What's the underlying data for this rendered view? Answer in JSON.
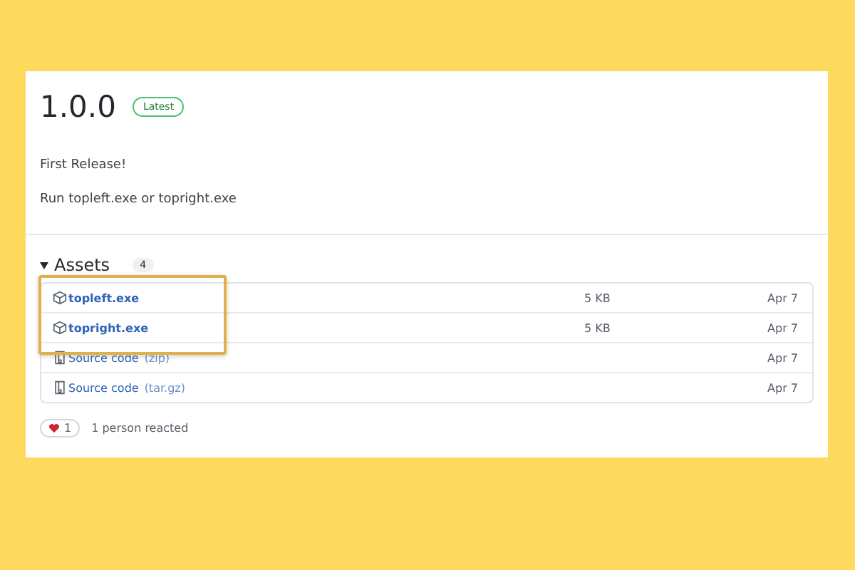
{
  "release": {
    "version": "1.0.0",
    "badge": "Latest",
    "notes": [
      "First Release!",
      "Run topleft.exe or topright.exe"
    ]
  },
  "assets": {
    "title": "Assets",
    "count": "4",
    "expanded": true,
    "items": [
      {
        "kind": "package",
        "name": "topleft.exe",
        "size": "5 KB",
        "date": "Apr 7",
        "highlighted": true
      },
      {
        "kind": "package",
        "name": "topright.exe",
        "size": "5 KB",
        "date": "Apr 7",
        "highlighted": true
      },
      {
        "kind": "source",
        "name": "Source code",
        "suffix": "(zip)",
        "date": "Apr 7",
        "highlighted": false
      },
      {
        "kind": "source",
        "name": "Source code",
        "suffix": "(tar.gz)",
        "date": "Apr 7",
        "highlighted": false
      }
    ]
  },
  "reactions": {
    "count": "1",
    "summary": "1 person reacted"
  }
}
